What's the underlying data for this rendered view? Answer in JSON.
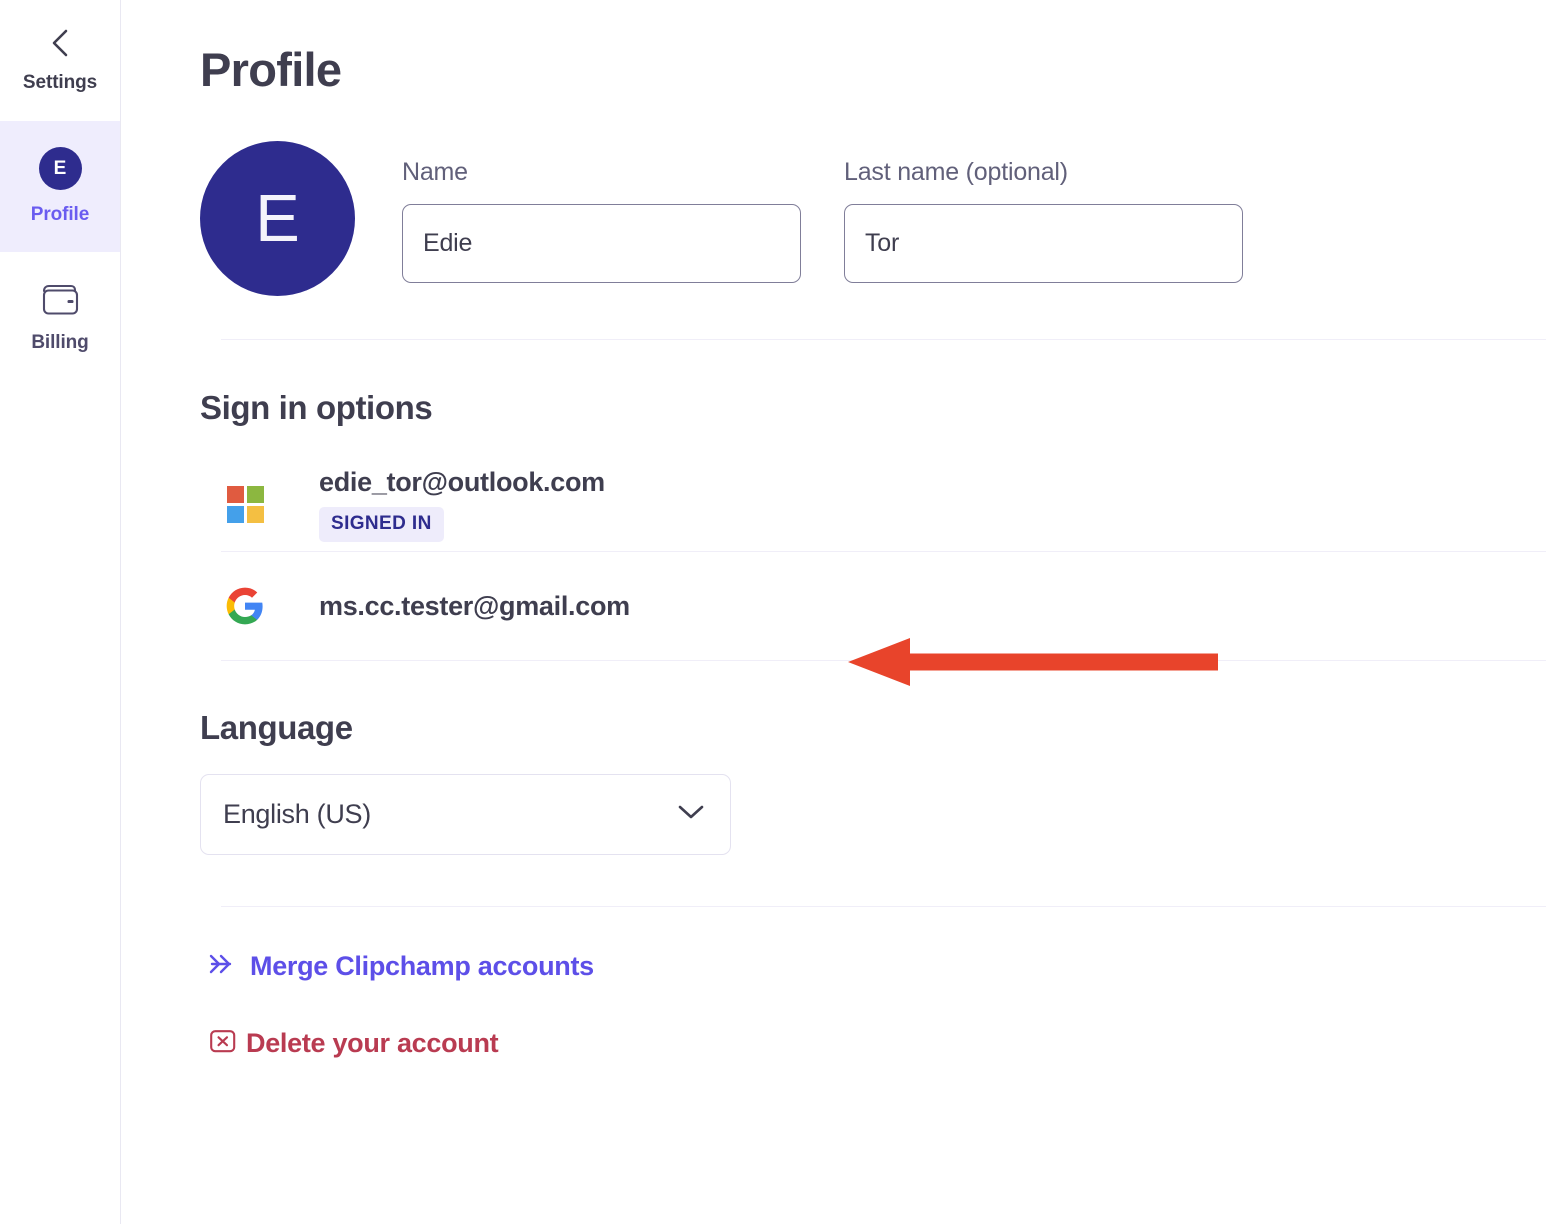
{
  "sidebar": {
    "back": {
      "label": "Settings",
      "icon": "chevron-left-icon"
    },
    "items": [
      {
        "label": "Profile",
        "icon": "avatar-icon",
        "avatar_letter": "E",
        "active": true
      },
      {
        "label": "Billing",
        "icon": "wallet-icon",
        "active": false
      }
    ]
  },
  "main": {
    "page_title": "Profile",
    "profile": {
      "avatar_letter": "E",
      "fields": [
        {
          "label": "Name",
          "value": "Edie",
          "placeholder": "Name"
        },
        {
          "label": "Last name (optional)",
          "value": "Tor",
          "placeholder": "Last name"
        }
      ]
    },
    "signin": {
      "title": "Sign in options",
      "accounts": [
        {
          "provider": "microsoft",
          "icon": "microsoft-logo-icon",
          "email": "edie_tor@outlook.com",
          "badge": "SIGNED IN"
        },
        {
          "provider": "google",
          "icon": "google-logo-icon",
          "email": "ms.cc.tester@gmail.com",
          "badge": ""
        }
      ]
    },
    "language": {
      "title": "Language",
      "selected": "English (US)",
      "chevron": "chevron-down-icon"
    },
    "links": [
      {
        "label": "Merge Clipchamp accounts",
        "icon": "double-chevron-right-icon",
        "color": "#5d4fe8"
      },
      {
        "label": "Delete your account",
        "icon": "boxed-x-icon",
        "color": "#b93b51"
      }
    ]
  },
  "annotation": {
    "type": "arrow-left",
    "color": "#e8442b",
    "points_at": "ms.cc.tester@gmail.com"
  },
  "colors": {
    "accent_purple": "#5d4fe8",
    "avatar_indigo": "#2e2c8e",
    "active_nav_bg": "#efedfd",
    "badge_bg": "#eeecfb",
    "badge_text": "#2e2c8e",
    "danger_red": "#b93b51",
    "annotation_red": "#e8442b",
    "text_primary": "#3f3e4f",
    "text_secondary": "#61607a",
    "divider": "#f0eef8"
  }
}
